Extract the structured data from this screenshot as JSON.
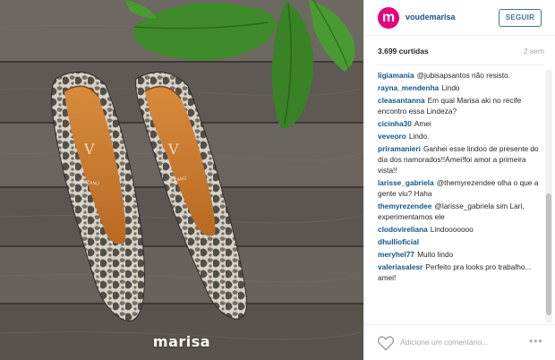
{
  "photo": {
    "watermark": "marisa",
    "shoe_label_left": "VIZZANO",
    "shoe_label_right": "VIZZANO"
  },
  "header": {
    "avatar_letter": "m",
    "username": "voudemarisa",
    "follow_label": "SEGUIR"
  },
  "meta": {
    "likes": "3.699 curtidas",
    "age": "2 sem"
  },
  "comments": [
    {
      "user": "ligiamania",
      "text": "@jubisapsantos não resisto."
    },
    {
      "user": "rayna_mendenha",
      "text": "Lindo"
    },
    {
      "user": "cleasantanna",
      "text": "Em qual Marisa aki no recife encontro essa Lindeza?"
    },
    {
      "user": "cicinha30",
      "text": "Amei"
    },
    {
      "user": "veveoro",
      "text": "Lindo."
    },
    {
      "user": "priramanieri",
      "text": "Ganhei esse lindoo de presente do dia dos namorados!!Amei!foi amor a primeira vista!!"
    },
    {
      "user": "larisse_gabriela",
      "text": "@themyrezendee olha o que a gente viu? Haha"
    },
    {
      "user": "themyrezendee",
      "text": "@larisse_gabriela sim Lari, experimentamos ele"
    },
    {
      "user": "clodovireliana",
      "text": "Lindooooooo"
    },
    {
      "user": "dhullioficial",
      "text": ""
    },
    {
      "user": "meryhel77",
      "text": "Muito lindo"
    },
    {
      "user": "valeriasalesr",
      "text": "Perfeito pra looks pro trabalho... amei!"
    }
  ],
  "footer": {
    "add_comment_placeholder": "Adicione um comentário...",
    "more_label": "•••"
  },
  "colors": {
    "brand": "#e5007e",
    "link": "#125688",
    "follow": "#3f729b"
  }
}
